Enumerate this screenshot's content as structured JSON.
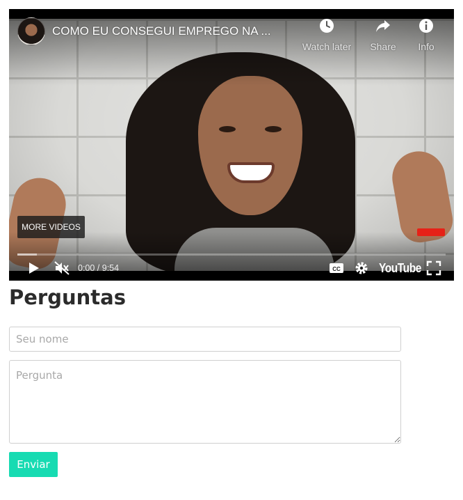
{
  "video": {
    "title": "COMO EU CONSEGUI EMPREGO NA PANDEMIA",
    "actions": {
      "watch_later": "Watch later",
      "share": "Share",
      "info": "Info"
    },
    "more_videos": "MORE VIDEOS",
    "time": "0:00 / 9:54",
    "progress_loaded": 0.045,
    "logo": "YouTube",
    "icons": [
      "play-icon",
      "mute-icon",
      "closed-captions-icon",
      "settings-gear-icon",
      "fullscreen-icon",
      "clock-icon",
      "share-arrow-icon",
      "info-icon"
    ]
  },
  "form": {
    "heading": "Perguntas",
    "name_placeholder": "Seu nome",
    "question_placeholder": "Pergunta",
    "submit_label": "Enviar",
    "accent_color": "#17dbb2"
  }
}
